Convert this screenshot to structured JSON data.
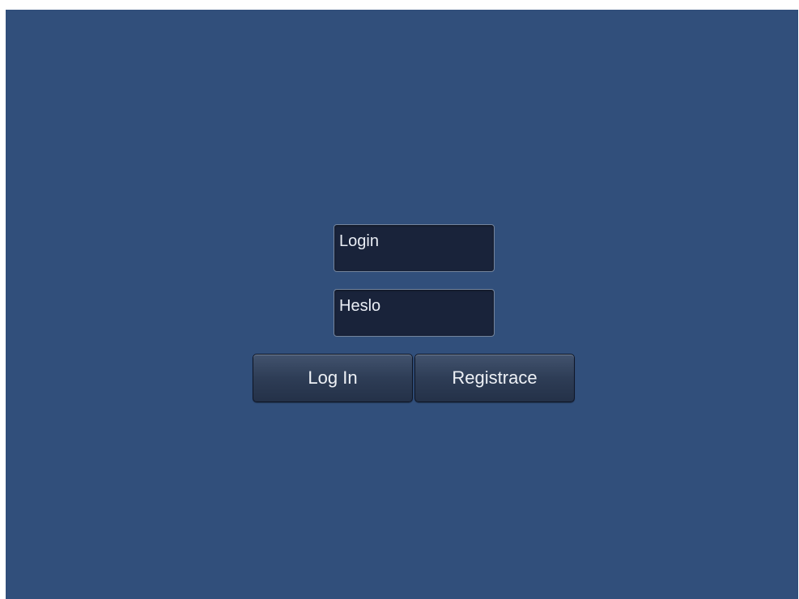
{
  "login_form": {
    "login_field": {
      "placeholder": "Login",
      "value": ""
    },
    "password_field": {
      "placeholder": "Heslo",
      "value": ""
    },
    "login_button_label": "Log In",
    "register_button_label": "Registrace"
  },
  "colors": {
    "background": "#314f7b",
    "field_background": "#19233a",
    "button_background": "#2e3d56",
    "text": "#e9edf4"
  }
}
